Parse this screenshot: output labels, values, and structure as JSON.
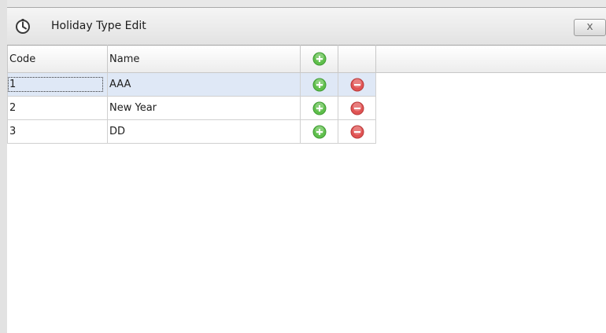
{
  "window": {
    "title": "Holiday Type Edit",
    "close_label": "x",
    "icon": "clock-icon"
  },
  "grid": {
    "columns": {
      "code": "Code",
      "name": "Name",
      "add_icon": "add-icon",
      "remove_icon": "remove-icon"
    },
    "rows": [
      {
        "code": "1",
        "name": "AAA",
        "selected": true
      },
      {
        "code": "2",
        "name": "New Year",
        "selected": false
      },
      {
        "code": "3",
        "name": "DD",
        "selected": false
      }
    ]
  },
  "colors": {
    "add_green": "#5fbf4b",
    "remove_red": "#e05353",
    "selected_row": "#dfe8f6"
  }
}
